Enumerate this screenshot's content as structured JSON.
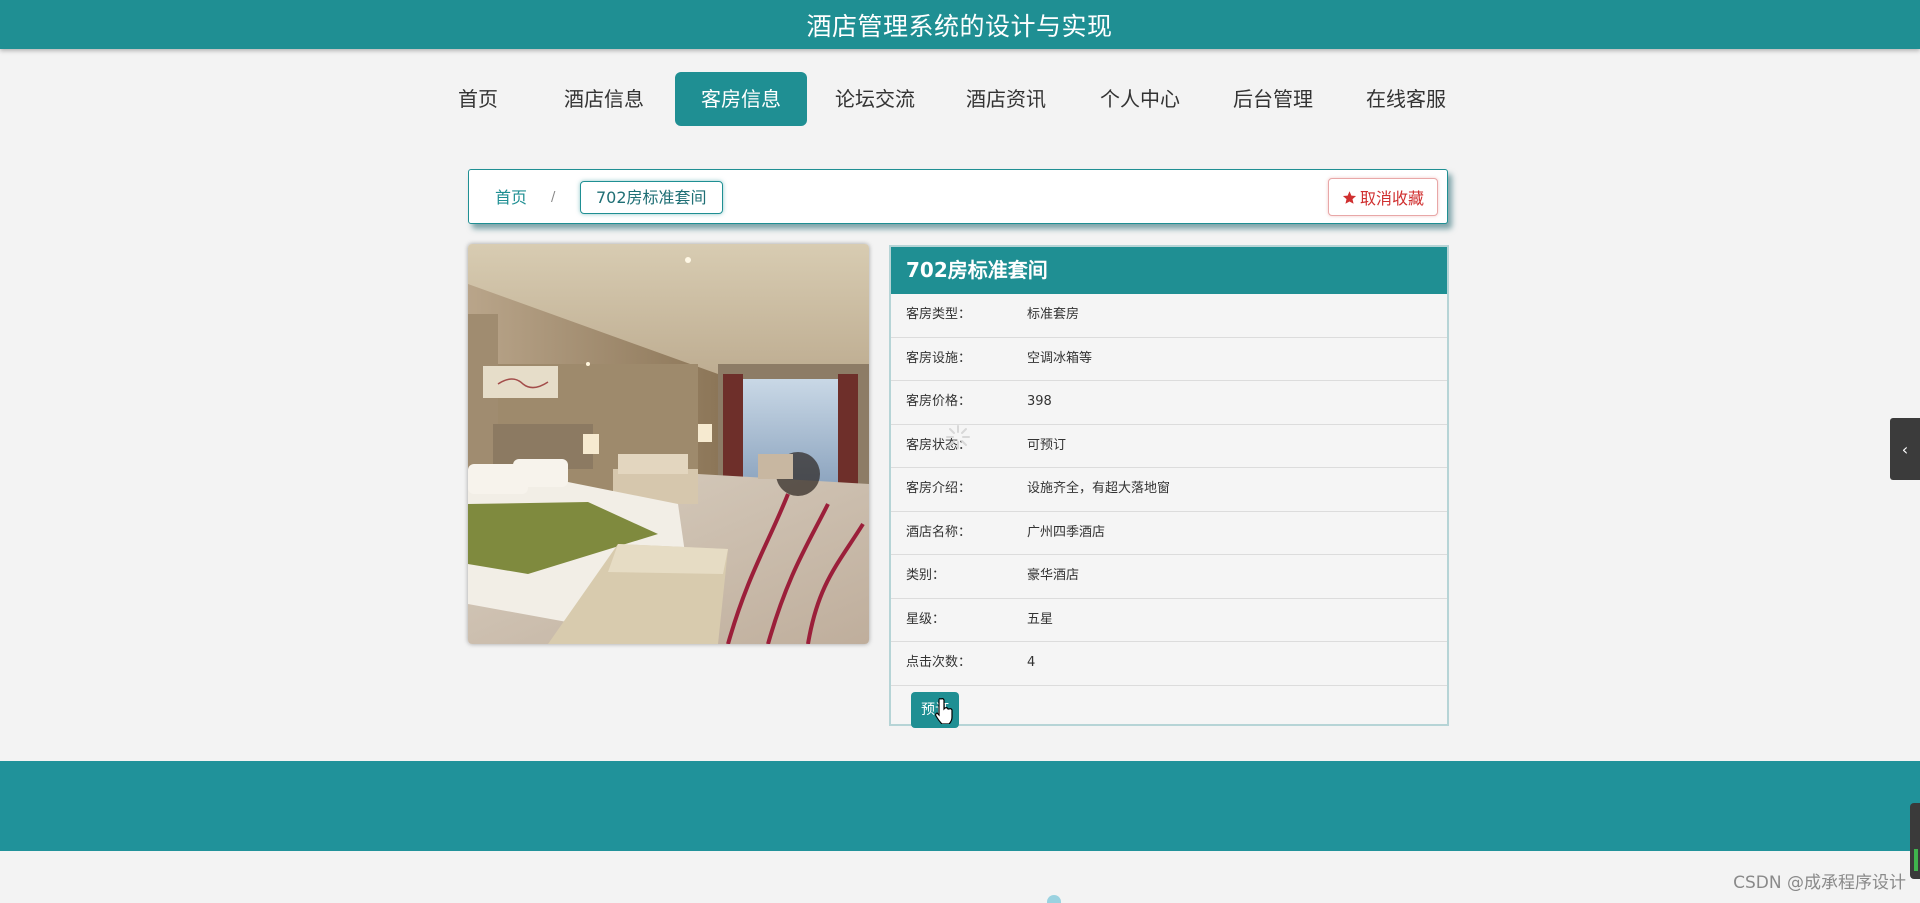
{
  "header": {
    "title": "酒店管理系统的设计与实现"
  },
  "nav": {
    "items": [
      {
        "label": "首页"
      },
      {
        "label": "酒店信息"
      },
      {
        "label": "客房信息"
      },
      {
        "label": "论坛交流"
      },
      {
        "label": "酒店资讯"
      },
      {
        "label": "个人中心"
      },
      {
        "label": "后台管理"
      },
      {
        "label": "在线客服"
      }
    ],
    "active_index": 2
  },
  "breadcrumb": {
    "home": "首页",
    "separator": "/",
    "current": "702房标准套间",
    "favorite_label": "取消收藏"
  },
  "room": {
    "title": "702房标准套间",
    "fields": [
      {
        "label": "客房类型：",
        "value": "标准套房"
      },
      {
        "label": "客房设施：",
        "value": "空调冰箱等"
      },
      {
        "label": "客房价格：",
        "value": "398"
      },
      {
        "label": "客房状态：",
        "value": "可预订"
      },
      {
        "label": "客房介绍：",
        "value": "设施齐全，有超大落地窗"
      },
      {
        "label": "酒店名称：",
        "value": "广州四季酒店"
      },
      {
        "label": "类别：",
        "value": "豪华酒店"
      },
      {
        "label": "星级：",
        "value": "五星"
      },
      {
        "label": "点击次数：",
        "value": "4"
      }
    ],
    "book_label": "预订"
  },
  "watermark": "CSDN @成承程序设计",
  "colors": {
    "primary": "#1f8f93",
    "danger": "#d03030"
  }
}
